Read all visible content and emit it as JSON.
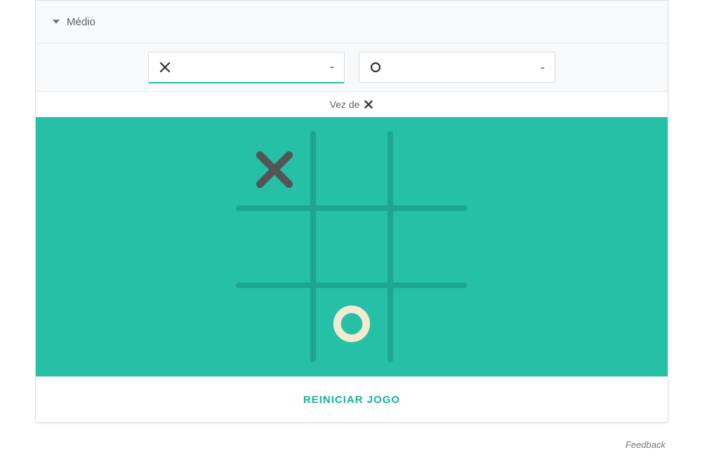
{
  "colors": {
    "accent": "#26c0a6",
    "accent_dark": "#1ea58f",
    "x_mark": "#545454",
    "o_mark": "#f2ead1"
  },
  "difficulty": {
    "label": "Médio"
  },
  "score": {
    "x": {
      "symbol": "X",
      "value": "-",
      "active": true
    },
    "o": {
      "symbol": "O",
      "value": "-",
      "active": false
    }
  },
  "turn": {
    "prefix": "Vez de",
    "symbol": "X"
  },
  "board": {
    "cells": [
      "X",
      "",
      "",
      "",
      "",
      "",
      "",
      "O",
      ""
    ]
  },
  "restart_label": "REINICIAR JOGO",
  "feedback_label": "Feedback"
}
